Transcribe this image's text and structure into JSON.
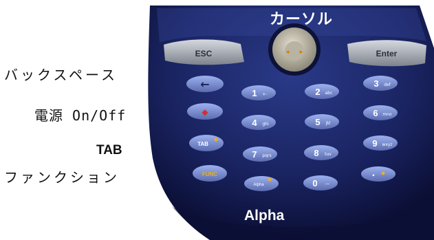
{
  "labels": {
    "backspace": "バックスペース",
    "power": "電源 On/Off",
    "tab": "TAB",
    "function": "ファンクション",
    "cursor": "カーソル",
    "alpha": "Alpha"
  },
  "keys": {
    "esc": "ESC",
    "enter": "Enter",
    "backspace_glyph": "←",
    "k1": "1",
    "k2": "2",
    "k3": "3",
    "k4": "4",
    "k5": "5",
    "k6": "6",
    "k7": "7",
    "k8": "8",
    "k9": "9",
    "k0": "0",
    "dot": ".",
    "tab": "TAB",
    "func": "FUNC",
    "k1_sub": "+-",
    "k2_sub": "abc",
    "k3_sub": "def",
    "k4_sub": "ghi",
    "k5_sub": "jkl",
    "k6_sub": "mno",
    "k7_sub": "pqrs",
    "k8_sub": "tuv",
    "k9_sub": "wxyz",
    "k0_sub": "—",
    "alpha_key": "Alpha"
  },
  "colors": {
    "body": "#1e2a6e",
    "body_dark": "#0f1440",
    "key": "#7c8fd0",
    "key_text": "#ffffff",
    "side_key": "#9aa0a8",
    "accent": "#e0b030",
    "power": "#d03030"
  }
}
